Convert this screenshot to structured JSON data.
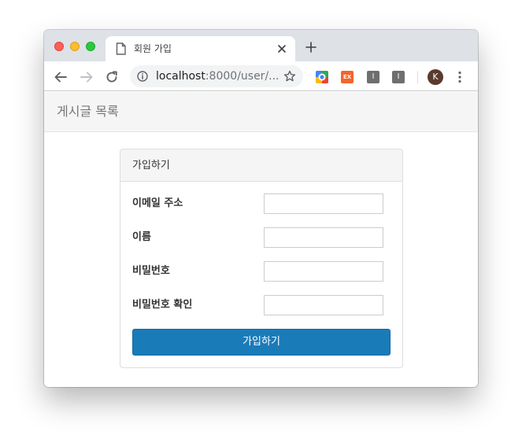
{
  "browser": {
    "tab_title": "회원 가입",
    "url_host": "localhost",
    "url_rest": ":8000/user/...",
    "avatar_initial": "K",
    "extensions": [
      {
        "name": "google-extension-icon"
      },
      {
        "name": "ex-extension-icon",
        "label": "EX"
      },
      {
        "name": "i-extension-icon",
        "label": "I"
      },
      {
        "name": "i-extension-icon",
        "label": "I"
      }
    ]
  },
  "navbar": {
    "brand": "게시글 목록"
  },
  "panel": {
    "title": "가입하기",
    "fields": [
      {
        "label": "이메일 주소",
        "value": ""
      },
      {
        "label": "이름",
        "value": ""
      },
      {
        "label": "비밀번호",
        "value": ""
      },
      {
        "label": "비밀번호 확인",
        "value": ""
      }
    ],
    "submit_label": "가입하기"
  },
  "colors": {
    "primary_button": "#1a7bb9",
    "navbar_bg": "#f5f5f5",
    "tabstrip_bg": "#dee1e6"
  }
}
